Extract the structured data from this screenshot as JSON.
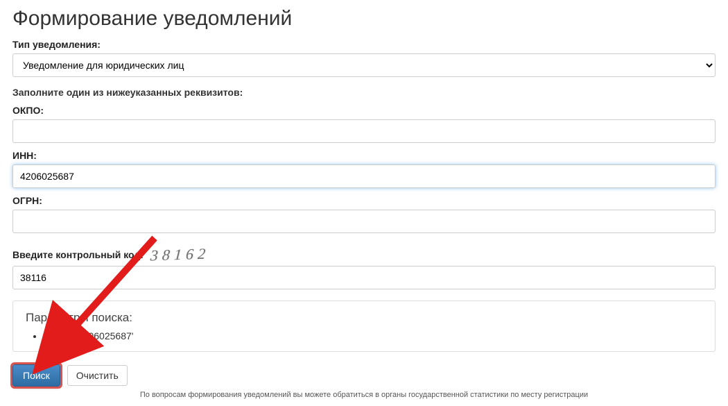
{
  "page_title": "Формирование уведомлений",
  "notification_type": {
    "label": "Тип уведомления:",
    "selected": "Уведомление для юридических лиц"
  },
  "fill_one_heading": "Заполните один из нижеуказанных реквизитов:",
  "okpo": {
    "label": "ОКПО:",
    "value": ""
  },
  "inn": {
    "label": "ИНН:",
    "value": "4206025687"
  },
  "ogrn": {
    "label": "ОГРН:",
    "value": ""
  },
  "captcha": {
    "label": "Введите контрольный код:",
    "image_text": "38162",
    "value": "38116"
  },
  "search_params": {
    "title": "Параметры поиска:",
    "items": [
      "ИНН = '4206025687'"
    ]
  },
  "buttons": {
    "search": "Поиск",
    "clear": "Очистить"
  },
  "footer": "По вопросам формирования уведомлений вы можете обратиться в органы государственной статистики по месту регистрации"
}
